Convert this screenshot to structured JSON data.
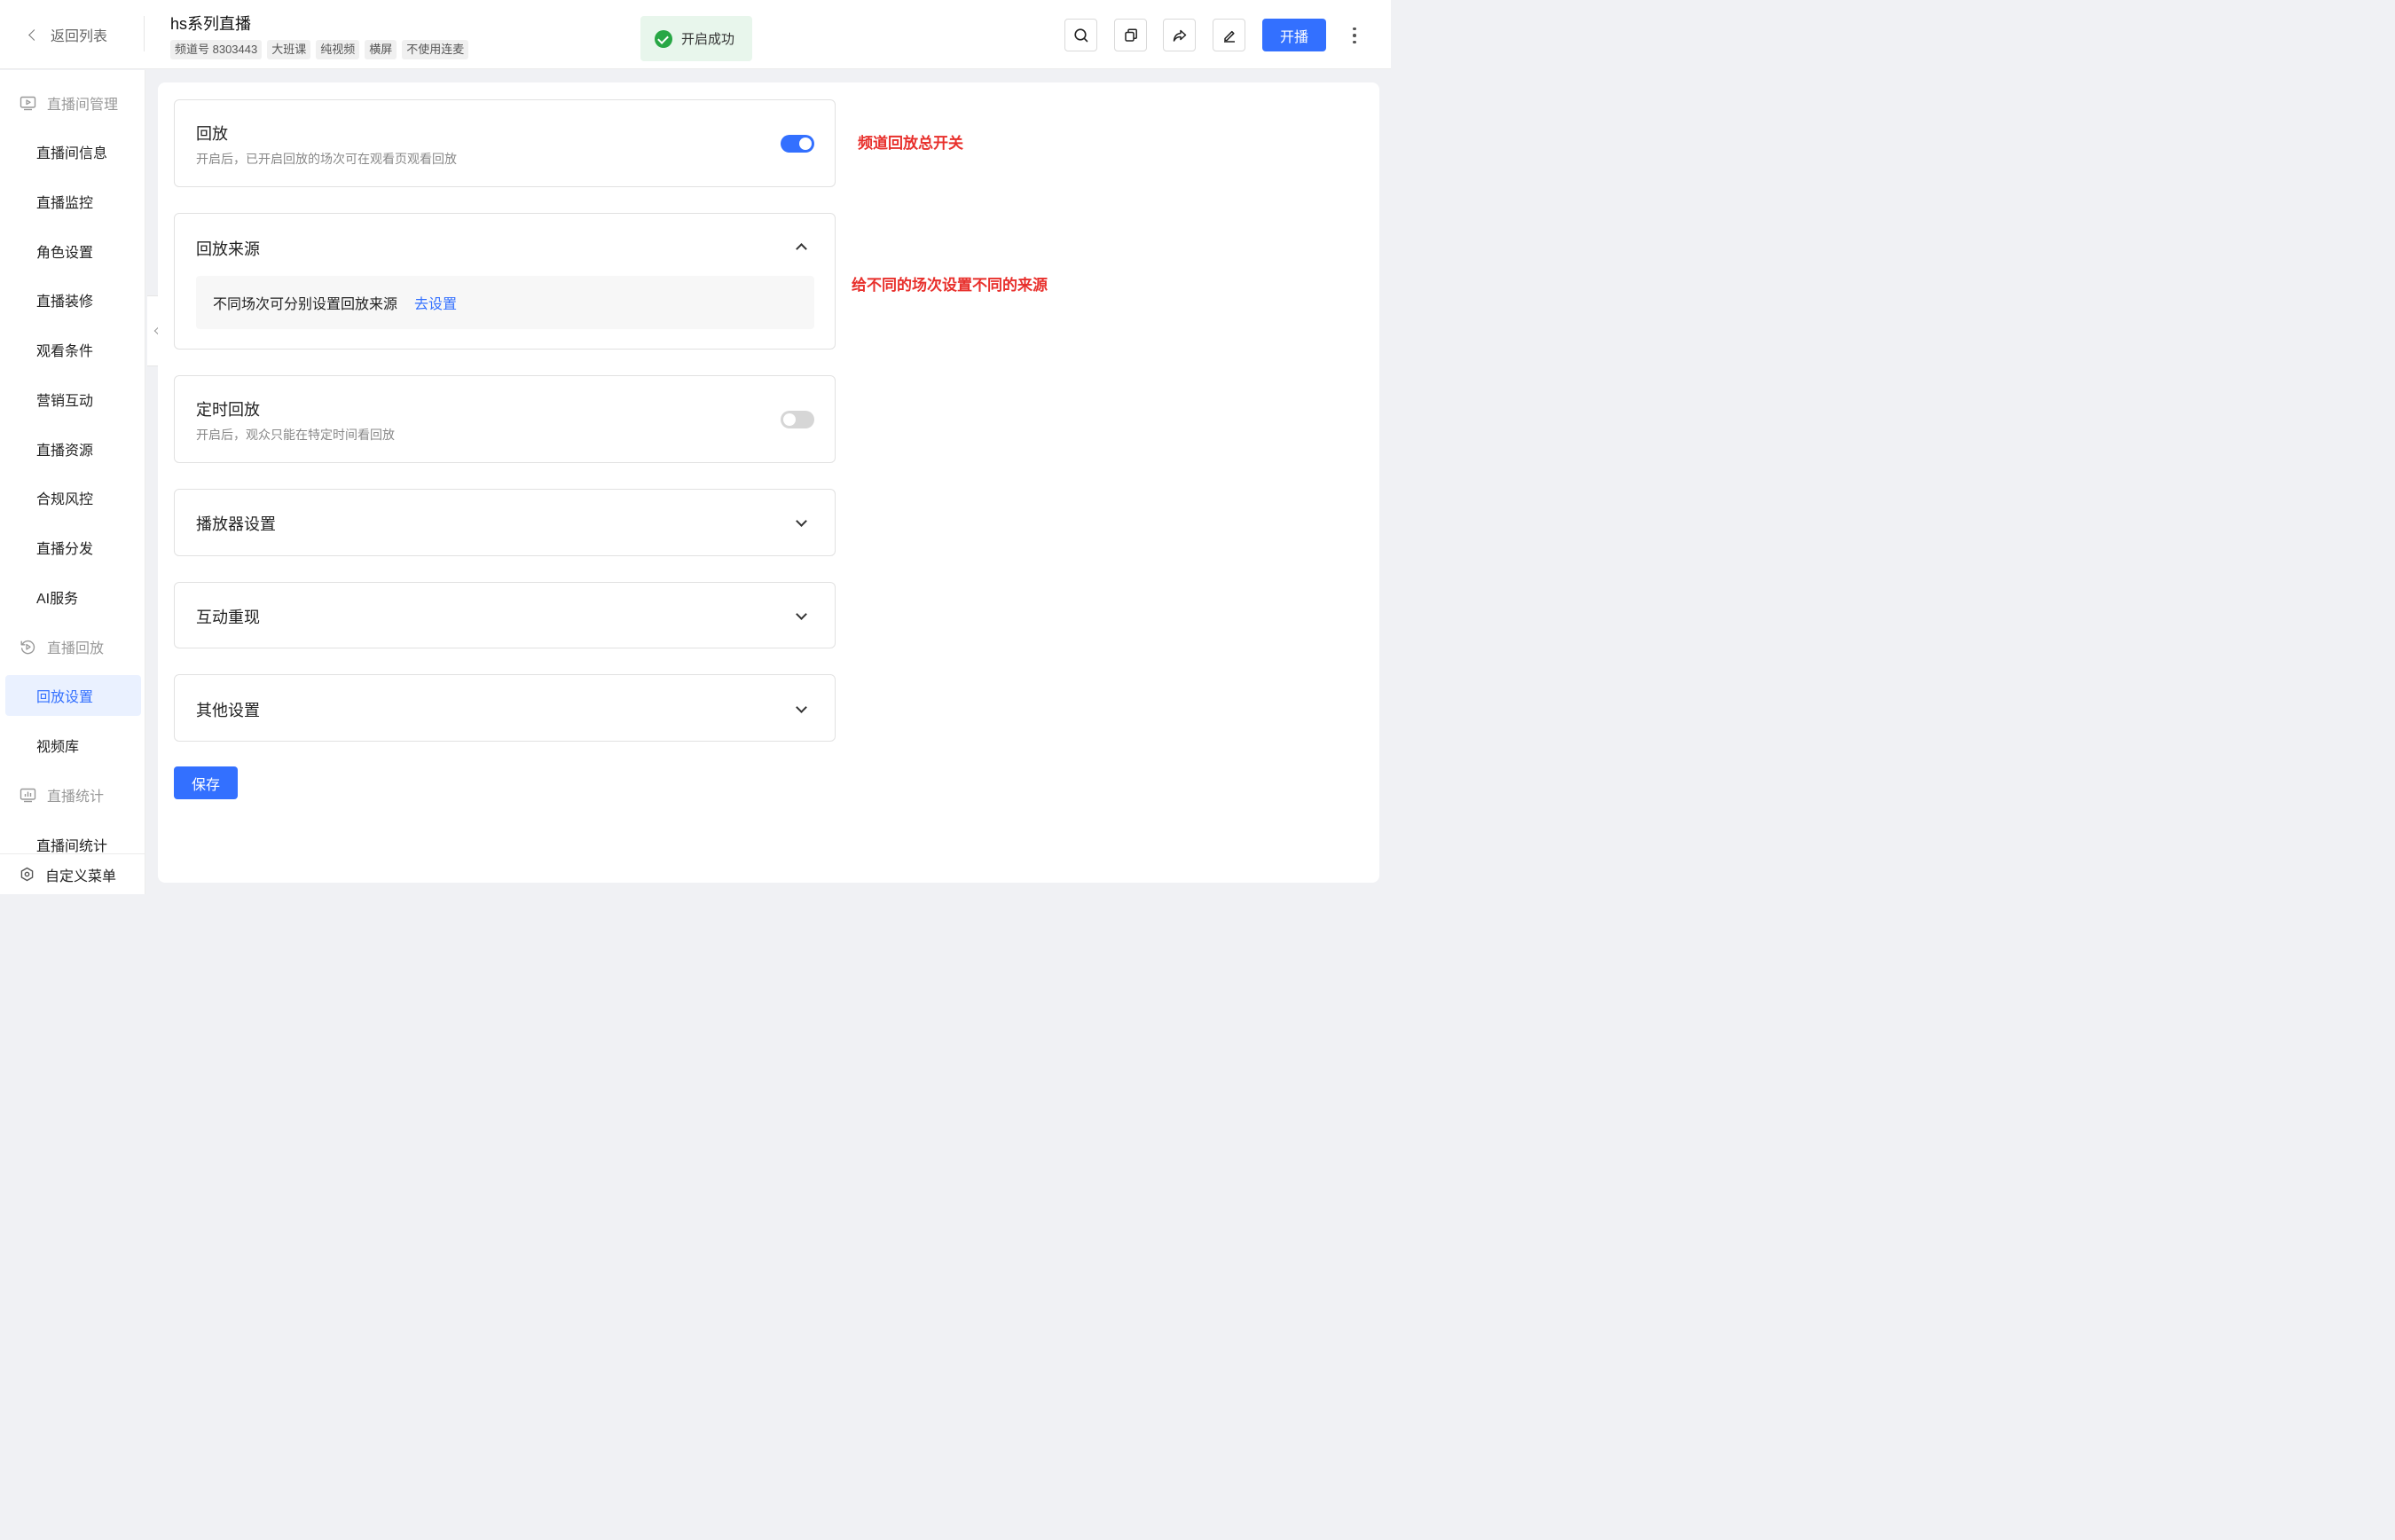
{
  "header": {
    "back_label": "返回列表",
    "title": "hs系列直播",
    "tags": [
      "频道号 8303443",
      "大班课",
      "纯视频",
      "横屏",
      "不使用连麦"
    ],
    "toast": "开启成功",
    "start_button": "开播"
  },
  "sidebar": {
    "group_live_manage": "直播间管理",
    "items_manage": [
      "直播间信息",
      "直播监控",
      "角色设置",
      "直播装修",
      "观看条件",
      "营销互动",
      "直播资源",
      "合规风控",
      "直播分发",
      "AI服务"
    ],
    "group_replay": "直播回放",
    "items_replay": [
      "回放设置",
      "视频库"
    ],
    "active_item": "回放设置",
    "group_stats": "直播统计",
    "items_stats": [
      "直播间统计"
    ],
    "custom_menu": "自定义菜单"
  },
  "main": {
    "replay": {
      "title": "回放",
      "desc": "开启后，已开启回放的场次可在观看页观看回放",
      "enabled": true
    },
    "replay_source": {
      "title": "回放来源",
      "text": "不同场次可分别设置回放来源",
      "link": "去设置",
      "expanded": true
    },
    "timed_replay": {
      "title": "定时回放",
      "desc": "开启后，观众只能在特定时间看回放",
      "enabled": false
    },
    "player_settings": {
      "title": "播放器设置",
      "expanded": false
    },
    "interaction_replay": {
      "title": "互动重现",
      "expanded": false
    },
    "other_settings": {
      "title": "其他设置",
      "expanded": false
    },
    "save_button": "保存"
  },
  "annotations": {
    "note1": "频道回放总开关",
    "note2": "给不同的场次设置不同的来源",
    "color": "#e8302c"
  },
  "colors": {
    "accent": "#3370ff",
    "success": "#28a745"
  }
}
